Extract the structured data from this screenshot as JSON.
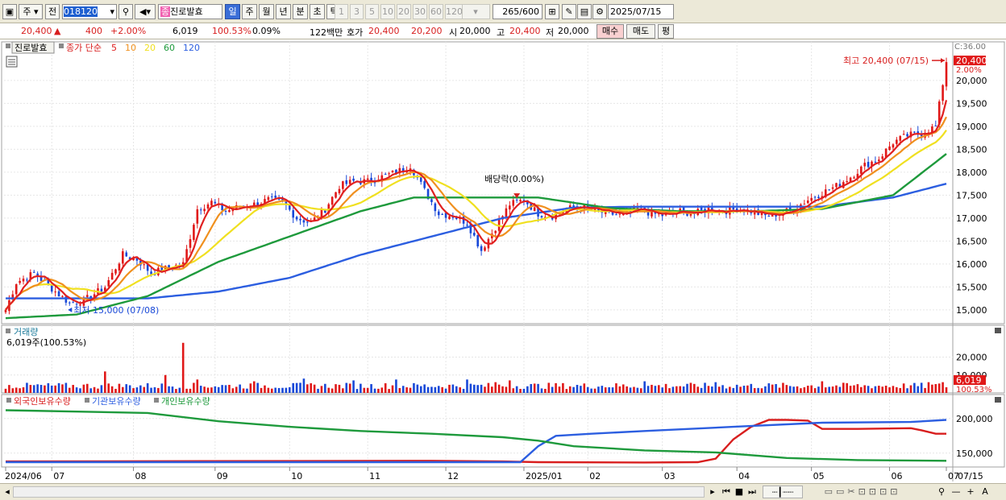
{
  "toolbar": {
    "market_1": "주",
    "market_2": "전",
    "code": "018120",
    "name": "진로발효",
    "periods": [
      "일",
      "주",
      "월",
      "년",
      "분",
      "초",
      "틱"
    ],
    "selected_period": "일",
    "minutes": [
      "1",
      "3",
      "5",
      "10",
      "20",
      "30",
      "60",
      "120"
    ],
    "count": "265",
    "count_total": "/600",
    "date": "2025/07/15"
  },
  "quote": {
    "price": "20,400",
    "change": "400",
    "change_pct": "+2.00%",
    "volume": "6,019",
    "volume_ratio": "100.53%",
    "turnover": "0.09%",
    "amount": "122백만",
    "hoga_label": "호가",
    "ask": "20,400",
    "bid": "20,200",
    "open_label": "시",
    "open": "20,000",
    "high_label": "고",
    "high": "20,400",
    "low_label": "저",
    "low": "20,000",
    "buy_label": "매수",
    "sell_label": "매도",
    "eval_label": "평"
  },
  "chart_data": [
    {
      "type": "candlestick",
      "title": "진로발효",
      "legend_prefix": "종가 단순",
      "ma_periods": [
        "5",
        "10",
        "20",
        "60",
        "120"
      ],
      "ma_colors": [
        "#e02020",
        "#f0901e",
        "#f0e020",
        "#1e9a3c",
        "#2c5ee0"
      ],
      "ylim": [
        14700,
        20700
      ],
      "ticks": [
        "20,000",
        "19,500",
        "19,000",
        "18,500",
        "18,000",
        "17,500",
        "17,000",
        "16,500",
        "16,000",
        "15,500",
        "15,000"
      ],
      "tick_values": [
        20000,
        19500,
        19000,
        18500,
        18000,
        17500,
        17000,
        16500,
        16000,
        15500,
        15000
      ],
      "top_label": "C:36.00",
      "price_badge": "20,400",
      "price_badge_pct": "2.00%",
      "high_annotation": "최고 20,400 (07/15)",
      "low_annotation": "최저 15,000 (07/08)",
      "dividend_annotation": "배당락(0.00%)",
      "anchors": [
        [
          0,
          15000
        ],
        [
          3,
          15600
        ],
        [
          8,
          15800
        ],
        [
          14,
          15400
        ],
        [
          18,
          15150
        ],
        [
          22,
          15200
        ],
        [
          28,
          15500
        ],
        [
          33,
          16200
        ],
        [
          37,
          16100
        ],
        [
          41,
          15800
        ],
        [
          45,
          15900
        ],
        [
          50,
          16000
        ],
        [
          54,
          17200
        ],
        [
          58,
          17350
        ],
        [
          62,
          17150
        ],
        [
          66,
          17250
        ],
        [
          70,
          17300
        ],
        [
          74,
          17400
        ],
        [
          78,
          17350
        ],
        [
          82,
          17000
        ],
        [
          86,
          16900
        ],
        [
          90,
          17200
        ],
        [
          94,
          17700
        ],
        [
          98,
          17800
        ],
        [
          102,
          17800
        ],
        [
          106,
          17900
        ],
        [
          110,
          18000
        ],
        [
          114,
          18150
        ],
        [
          118,
          17600
        ],
        [
          122,
          17100
        ],
        [
          126,
          17050
        ],
        [
          130,
          16900
        ],
        [
          134,
          16300
        ],
        [
          138,
          16800
        ],
        [
          142,
          17300
        ],
        [
          146,
          17400
        ],
        [
          150,
          17100
        ],
        [
          154,
          17050
        ],
        [
          158,
          17200
        ],
        [
          162,
          17250
        ],
        [
          166,
          17150
        ],
        [
          170,
          17100
        ],
        [
          174,
          17050
        ],
        [
          178,
          17200
        ],
        [
          182,
          17100
        ],
        [
          186,
          17050
        ],
        [
          190,
          17150
        ],
        [
          194,
          17100
        ],
        [
          198,
          17200
        ],
        [
          202,
          17150
        ],
        [
          206,
          17200
        ],
        [
          210,
          17150
        ],
        [
          214,
          17050
        ],
        [
          218,
          17100
        ],
        [
          222,
          17200
        ],
        [
          226,
          17400
        ],
        [
          230,
          17550
        ],
        [
          234,
          17700
        ],
        [
          238,
          17900
        ],
        [
          242,
          18150
        ],
        [
          246,
          18300
        ],
        [
          250,
          18650
        ],
        [
          254,
          18800
        ],
        [
          258,
          18850
        ],
        [
          262,
          19000
        ],
        [
          265,
          20400
        ]
      ],
      "ma60_anchors": [
        [
          0,
          14820
        ],
        [
          20,
          14900
        ],
        [
          40,
          15300
        ],
        [
          60,
          16050
        ],
        [
          80,
          16600
        ],
        [
          100,
          17150
        ],
        [
          115,
          17450
        ],
        [
          130,
          17450
        ],
        [
          150,
          17450
        ],
        [
          170,
          17220
        ],
        [
          190,
          17150
        ],
        [
          210,
          17150
        ],
        [
          230,
          17200
        ],
        [
          250,
          17500
        ],
        [
          265,
          18400
        ]
      ],
      "ma120_anchors": [
        [
          0,
          15250
        ],
        [
          40,
          15250
        ],
        [
          60,
          15400
        ],
        [
          80,
          15700
        ],
        [
          100,
          16200
        ],
        [
          115,
          16500
        ],
        [
          140,
          17000
        ],
        [
          160,
          17230
        ],
        [
          180,
          17250
        ],
        [
          210,
          17250
        ],
        [
          230,
          17250
        ],
        [
          250,
          17450
        ],
        [
          265,
          17750
        ]
      ]
    },
    {
      "type": "bar",
      "title": "거래량",
      "subtitle": "6,019주(100.53%)",
      "ylim": [
        0,
        36000
      ],
      "ticks": [
        "20,000",
        "10,000"
      ],
      "tick_values": [
        20000,
        10000
      ],
      "last_badge": "6,019",
      "last_badge_pct": "100.53%",
      "spikes": [
        [
          28,
          12000
        ],
        [
          45,
          10000
        ],
        [
          50,
          28000
        ],
        [
          54,
          7500
        ],
        [
          70,
          6500
        ],
        [
          84,
          8000
        ],
        [
          98,
          7000
        ],
        [
          110,
          7500
        ],
        [
          130,
          7500
        ],
        [
          138,
          6000
        ],
        [
          142,
          7000
        ],
        [
          180,
          6500
        ],
        [
          200,
          6000
        ],
        [
          230,
          6500
        ],
        [
          260,
          6000
        ],
        [
          264,
          6000
        ]
      ]
    },
    {
      "type": "line",
      "series": [
        {
          "name": "외국인보유수량",
          "color": "#d81e1e",
          "points": [
            [
              0,
              138000
            ],
            [
              120,
              139000
            ],
            [
              140,
              138000
            ],
            [
              150,
              137000
            ],
            [
              180,
              136500
            ],
            [
              195,
              137000
            ],
            [
              200,
              142000
            ],
            [
              205,
              170000
            ],
            [
              210,
              188000
            ],
            [
              215,
              198000
            ],
            [
              220,
              198000
            ],
            [
              226,
              197000
            ],
            [
              230,
              185000
            ],
            [
              240,
              185000
            ],
            [
              255,
              186000
            ],
            [
              258,
              183000
            ],
            [
              262,
              178000
            ],
            [
              265,
              178000
            ]
          ]
        },
        {
          "name": "기관보유수량",
          "color": "#2c5ee0",
          "points": [
            [
              0,
              137000
            ],
            [
              140,
              137000
            ],
            [
              145,
              137000
            ],
            [
              150,
              160000
            ],
            [
              155,
              175000
            ],
            [
              165,
              178000
            ],
            [
              180,
              182000
            ],
            [
              205,
              188000
            ],
            [
              230,
              194000
            ],
            [
              255,
              195000
            ],
            [
              265,
              198000
            ]
          ]
        },
        {
          "name": "개인보유수량",
          "color": "#1e9a3c",
          "points": [
            [
              0,
              212000
            ],
            [
              40,
              208000
            ],
            [
              60,
              196000
            ],
            [
              80,
              188000
            ],
            [
              100,
              182000
            ],
            [
              120,
              178000
            ],
            [
              140,
              173000
            ],
            [
              150,
              168000
            ],
            [
              160,
              160000
            ],
            [
              180,
              154000
            ],
            [
              200,
              151000
            ],
            [
              220,
              143000
            ],
            [
              240,
              140000
            ],
            [
              265,
              139000
            ]
          ]
        }
      ],
      "ylim": [
        130000,
        230000
      ],
      "ticks": [
        "200,000",
        "150,000"
      ],
      "tick_values": [
        200000,
        150000
      ]
    }
  ],
  "x_axis": {
    "labels": [
      "2024/06",
      "07",
      "08",
      "09",
      "10",
      "11",
      "12",
      "2025/01",
      "02",
      "03",
      "04",
      "05",
      "06",
      "07"
    ],
    "positions": [
      0,
      13,
      36,
      59,
      80,
      102,
      124,
      146,
      164,
      185,
      206,
      227,
      249,
      265
    ],
    "last_date": "07/15"
  }
}
